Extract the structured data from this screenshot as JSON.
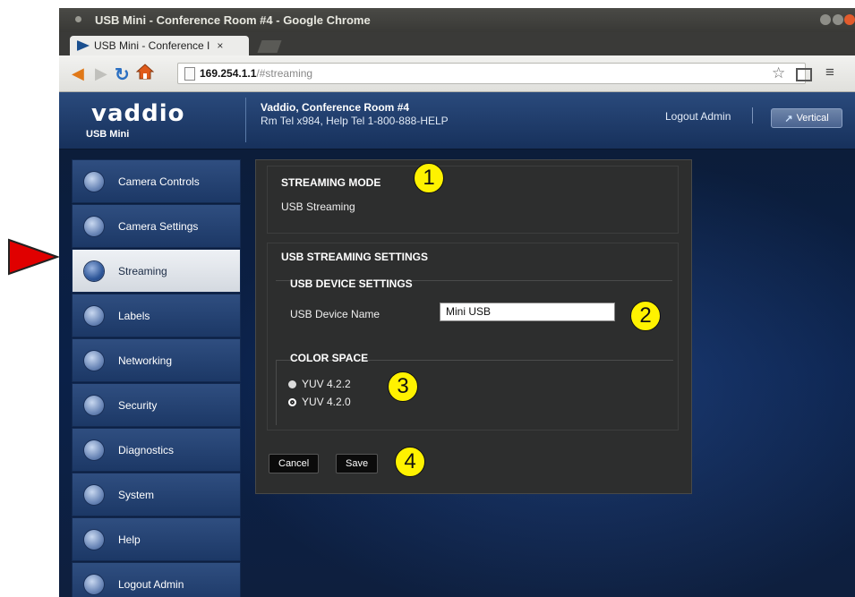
{
  "browser": {
    "window_title": "USB Mini - Conference Room #4 - Google Chrome",
    "tab_title": "USB Mini - Conference I",
    "tab_close": "×",
    "url_host": "169.254.1.1",
    "url_path": "/#streaming"
  },
  "header": {
    "logo": "vaddio",
    "product": "USB Mini",
    "device_title": "Vaddio, Conference Room #4",
    "device_phones": "Rm Tel x984, Help Tel 1-800-888-HELP",
    "logout": "Logout Admin",
    "vertical_button": "Vertical"
  },
  "sidebar": {
    "items": [
      {
        "label": "Camera Controls",
        "icon": "camera-controls-icon"
      },
      {
        "label": "Camera Settings",
        "icon": "camera-settings-icon"
      },
      {
        "label": "Streaming",
        "icon": "streaming-icon",
        "active": true
      },
      {
        "label": "Labels",
        "icon": "labels-icon"
      },
      {
        "label": "Networking",
        "icon": "networking-icon"
      },
      {
        "label": "Security",
        "icon": "lock-icon"
      },
      {
        "label": "Diagnostics",
        "icon": "diagnostics-icon"
      },
      {
        "label": "System",
        "icon": "system-gear-icon"
      },
      {
        "label": "Help",
        "icon": "help-icon"
      },
      {
        "label": "Logout Admin",
        "icon": "power-icon"
      }
    ]
  },
  "main": {
    "streaming_mode_heading": "STREAMING MODE",
    "streaming_mode_value": "USB Streaming",
    "usb_settings_heading": "USB STREAMING SETTINGS",
    "usb_device_heading": "USB DEVICE SETTINGS",
    "usb_device_name_label": "USB Device Name",
    "usb_device_name_value": "Mini USB",
    "color_space_heading": "COLOR SPACE",
    "color_options": [
      {
        "label": "YUV 4.2.2",
        "selected": false
      },
      {
        "label": "YUV 4.2.0",
        "selected": true
      }
    ],
    "cancel_button": "Cancel",
    "save_button": "Save"
  },
  "callouts": [
    "1",
    "2",
    "3",
    "4"
  ],
  "colors": {
    "accent_active_tab": "#e6eaef",
    "callout": "#fff200",
    "pointer": "#e00000",
    "panel": "#2d2e2e"
  }
}
